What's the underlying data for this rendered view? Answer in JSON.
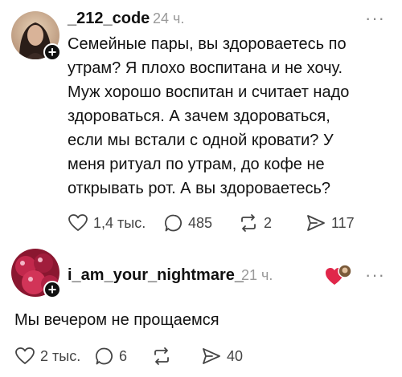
{
  "post": {
    "username": "_212_code",
    "time": "24 ч.",
    "text": "Семейные пары, вы здороваетесь по\nутрам? Я плохо воспитана и не хочу.\nМуж хорошо воспитан и считает надо\nздороваться. А зачем здороваться,\nесли мы встали с одной кровати? У\nменя ритуал по утрам, до кофе не\nоткрывать рот. А вы здороваетесь?",
    "more": "···",
    "likes": "1,4 тыс.",
    "comments": "485",
    "reposts": "2",
    "shares": "117"
  },
  "reply": {
    "username": "i_am_your_nightmare_",
    "time": "21 ч.",
    "text": "Мы вечером не прощаемся",
    "more": "···",
    "likes": "2 тыс.",
    "comments": "6",
    "shares": "40"
  },
  "icons": {
    "like": "heart-icon",
    "comment": "comment-bubble-icon",
    "repost": "repost-icon",
    "share": "share-arrow-icon",
    "follow": "plus-icon"
  },
  "colors": {
    "text": "#111111",
    "muted": "#9a9a9a",
    "icon": "#444444",
    "liked_heart": "#e0274a"
  }
}
